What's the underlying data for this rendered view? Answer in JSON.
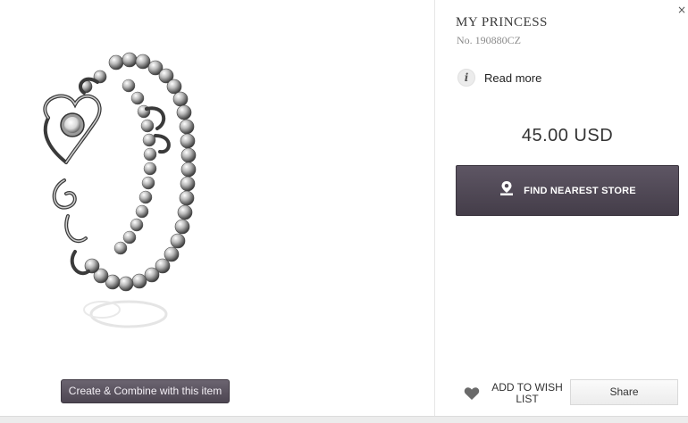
{
  "product": {
    "title": "MY PRINCESS",
    "number": "No. 190880CZ",
    "price": "45.00 USD",
    "image_icon": "tiara-ring-image"
  },
  "actions": {
    "read_more": "Read more",
    "find_store": "FIND NEAREST STORE",
    "wish_list": "ADD TO WISH LIST",
    "share": "Share",
    "combine": "Create & Combine with this item",
    "close": "×"
  },
  "icons": {
    "info": "info-icon",
    "pin": "map-pin-icon",
    "heart": "heart-icon",
    "close": "close-icon"
  },
  "colors": {
    "primary_button": "#4f4854",
    "text": "#333333",
    "muted": "#8a8a8a"
  }
}
